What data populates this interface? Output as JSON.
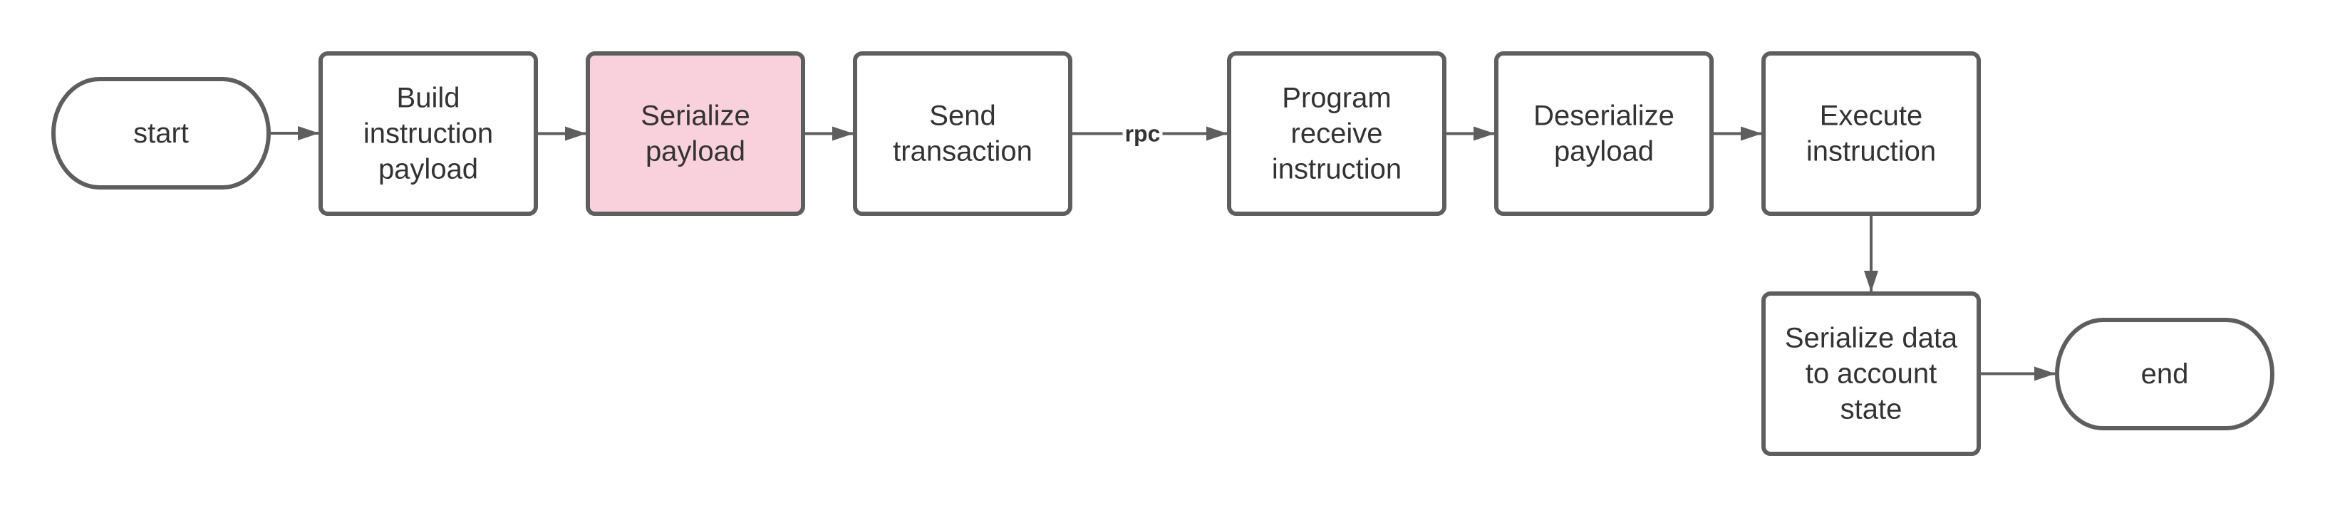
{
  "diagram": {
    "type": "flowchart",
    "colors": {
      "stroke": "#5e5e5e",
      "text": "#333333",
      "highlight_fill": "#f9d1dc",
      "default_fill": "#ffffff"
    },
    "nodes": [
      {
        "id": "start",
        "shape": "terminal",
        "lines": [
          "start"
        ],
        "highlighted": false
      },
      {
        "id": "build",
        "shape": "process",
        "lines": [
          "Build",
          "instruction",
          "payload"
        ],
        "highlighted": false
      },
      {
        "id": "serialize",
        "shape": "process",
        "lines": [
          "Serialize",
          "payload"
        ],
        "highlighted": true
      },
      {
        "id": "send",
        "shape": "process",
        "lines": [
          "Send",
          "transaction"
        ],
        "highlighted": false
      },
      {
        "id": "receive",
        "shape": "process",
        "lines": [
          "Program",
          "receive",
          "instruction"
        ],
        "highlighted": false
      },
      {
        "id": "deserialize",
        "shape": "process",
        "lines": [
          "Deserialize",
          "payload"
        ],
        "highlighted": false
      },
      {
        "id": "execute",
        "shape": "process",
        "lines": [
          "Execute",
          "instruction"
        ],
        "highlighted": false
      },
      {
        "id": "persist",
        "shape": "process",
        "lines": [
          "Serialize data",
          "to account",
          "state"
        ],
        "highlighted": false
      },
      {
        "id": "end",
        "shape": "terminal",
        "lines": [
          "end"
        ],
        "highlighted": false
      }
    ],
    "edges": [
      {
        "from": "start",
        "to": "build",
        "label": ""
      },
      {
        "from": "build",
        "to": "serialize",
        "label": ""
      },
      {
        "from": "serialize",
        "to": "send",
        "label": ""
      },
      {
        "from": "send",
        "to": "receive",
        "label": "rpc"
      },
      {
        "from": "receive",
        "to": "deserialize",
        "label": ""
      },
      {
        "from": "deserialize",
        "to": "execute",
        "label": ""
      },
      {
        "from": "execute",
        "to": "persist",
        "label": ""
      },
      {
        "from": "persist",
        "to": "end",
        "label": ""
      }
    ]
  }
}
